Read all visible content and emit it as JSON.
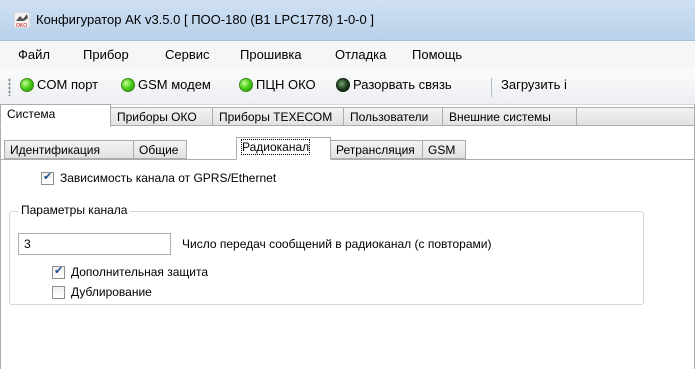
{
  "window": {
    "title": "Конфигуратор АК v3.5.0 [ ПОО-180 (B1 LPC1778) 1-0-0 ]",
    "icon": "oko-app-icon"
  },
  "menu": [
    "Файл",
    "Прибор",
    "Сервис",
    "Прошивка",
    "Отладка",
    "Помощь"
  ],
  "toolbar": {
    "com_port": "COM порт",
    "gsm_modem": "GSM модем",
    "pcn_oko": "ПЦН ОКО",
    "disconnect": "Разорвать связь",
    "load": "Загрузить і"
  },
  "main_tabs": [
    "Система",
    "Приборы ОКО",
    "Приборы ТЕХЕСОМ",
    "Пользователи",
    "Внешние системы"
  ],
  "main_tab_active": "Система",
  "sub_tabs": [
    "Идентификация",
    "Общие",
    "Радиоканал",
    "Ретрансляция",
    "GSM"
  ],
  "sub_tab_active": "Радиоканал",
  "radio": {
    "gprs_dependency_label": "Зависимость канала от GPRS/Ethernet",
    "gprs_dependency_checked": true,
    "group_title": "Параметры канала",
    "tx_count_value": "3",
    "tx_count_label": "Число передач сообщений в радиоканал (с повторами)",
    "extra_protection_label": "Дополнительная защита",
    "extra_protection_checked": true,
    "duplication_label": "Дублирование",
    "duplication_checked": false
  },
  "colors": {
    "led_on": "#4fd21d",
    "led_off": "#1d3a1d",
    "titlebar": "#c4d8ee"
  }
}
